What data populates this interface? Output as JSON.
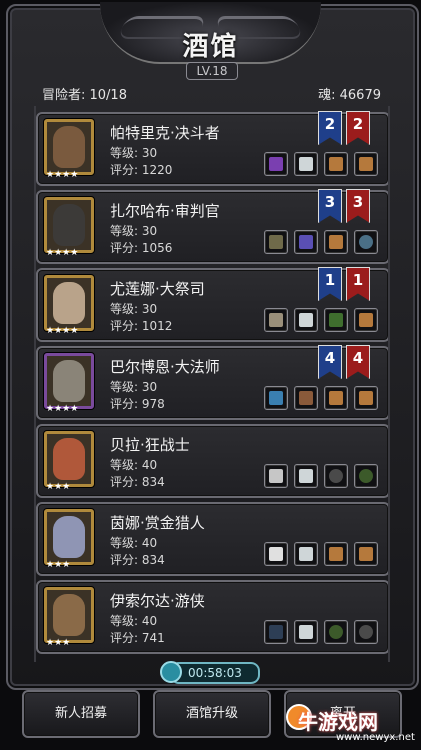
{
  "header": {
    "title": "酒馆",
    "level": "LV.18"
  },
  "stats": {
    "adventurers": "冒险者: 10/18",
    "souls": "魂: 46679"
  },
  "colors": {
    "gold_frame": "#b08a3c",
    "purple_frame": "#7a4a9c",
    "blue_badge": "#1f3f8a",
    "red_badge": "#9b1c1c",
    "timer": "#6fb7c4"
  },
  "heroes": [
    {
      "name": "帕特里克·决斗者",
      "level": "等级: 30",
      "score": "评分: 1220",
      "stars": "★★★★",
      "frame": "gold",
      "badge_blue": "2",
      "badge_red": "2",
      "slots": [
        "purple-weapon-icon",
        "green-armor-icon",
        "green-wood-icon",
        "green-wood-icon"
      ]
    },
    {
      "name": "扎尔哈布·审判官",
      "level": "等级: 30",
      "score": "评分: 1056",
      "stars": "★★★★",
      "frame": "gold",
      "badge_blue": "3",
      "badge_red": "3",
      "slots": [
        "green-hammer-icon",
        "purple-potion-icon",
        "blue-wood-icon",
        "blue-ring-icon"
      ]
    },
    {
      "name": "尤莲娜·大祭司",
      "level": "等级: 30",
      "score": "评分: 1012",
      "stars": "★★★★",
      "frame": "gold",
      "badge_blue": "1",
      "badge_red": "1",
      "slots": [
        "blue-staff-icon",
        "blue-armor-icon",
        "green-cape-icon",
        "blue-wood-icon"
      ]
    },
    {
      "name": "巴尔博恩·大法师",
      "level": "等级: 30",
      "score": "评分: 978",
      "stars": "★★★★",
      "frame": "purple",
      "badge_blue": "4",
      "badge_red": "4",
      "slots": [
        "blue-wand-icon",
        "blue-orb-icon",
        "blue-wood-icon",
        "purple-wood-icon"
      ]
    },
    {
      "name": "贝拉·狂战士",
      "level": "等级: 40",
      "score": "评分: 834",
      "stars": "★★★",
      "frame": "gold",
      "badge_blue": "",
      "badge_red": "",
      "slots": [
        "blue-axe-icon",
        "blue-armor-icon",
        "blue-ring-icon",
        "green-ring-icon"
      ]
    },
    {
      "name": "茵娜·赏金猎人",
      "level": "等级: 40",
      "score": "评分: 834",
      "stars": "★★★",
      "frame": "gold",
      "badge_blue": "",
      "badge_red": "",
      "slots": [
        "purple-blade-icon",
        "green-armor-icon",
        "blue-wood-icon",
        "green-wood-icon"
      ]
    },
    {
      "name": "伊索尔达·游侠",
      "level": "等级: 40",
      "score": "评分: 741",
      "stars": "★★★",
      "frame": "gold",
      "badge_blue": "",
      "badge_red": "",
      "slots": [
        "blue-blade-icon",
        "blue-armor-icon",
        "green-ring-icon",
        "blue-ring-icon"
      ]
    }
  ],
  "timer": "00:58:03",
  "buttons": {
    "recruit": "新人招募",
    "upgrade": "酒馆升级",
    "leave": "离开"
  },
  "watermark": {
    "brand": "牛游戏网",
    "url": "www.newyx.net"
  }
}
